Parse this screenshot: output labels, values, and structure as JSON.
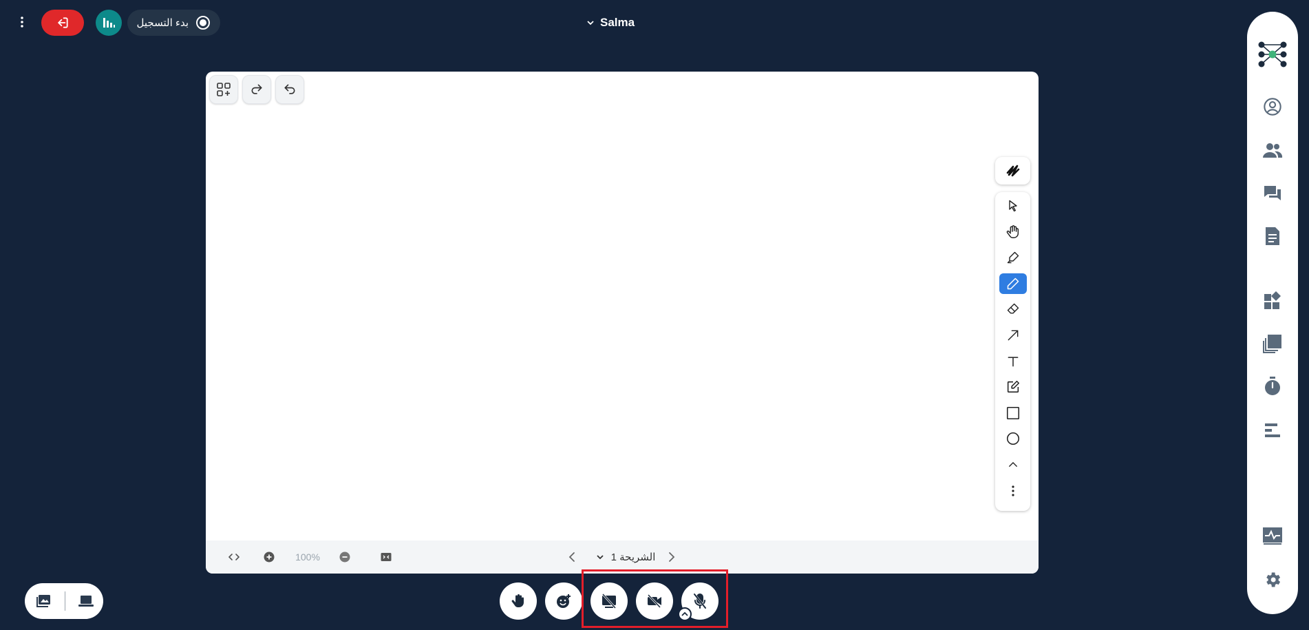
{
  "header": {
    "meeting_name": "Salma",
    "record_label": "بدء التسجيل"
  },
  "whiteboard": {
    "zoom_value": "100%",
    "slide_label": "الشريحة 1"
  },
  "colors": {
    "background": "#14233a",
    "leave": "#e0282a",
    "poll": "#0d8a8a",
    "tool_active": "#2f7de1",
    "highlight": "#e31e2a"
  },
  "icons": {
    "top_left": [
      "menu-kebab-icon",
      "leave-icon",
      "poll-icon",
      "record-icon"
    ],
    "board_top_left": [
      "add-shapes-icon",
      "redo-icon",
      "undo-icon"
    ],
    "tools": [
      "select-icon",
      "hand-pan-icon",
      "highlighter-icon",
      "pencil-icon",
      "eraser-icon",
      "arrow-icon",
      "text-icon",
      "sticky-note-icon",
      "rectangle-icon",
      "ellipse-icon",
      "chevron-up-icon",
      "more-vertical-icon"
    ],
    "sidebar": [
      "app-logo-icon",
      "user-icon",
      "users-icon",
      "chat-icon",
      "notes-icon",
      "apps-icon",
      "layers-icon",
      "timer-icon",
      "align-icon",
      "activity-icon",
      "settings-icon"
    ]
  }
}
